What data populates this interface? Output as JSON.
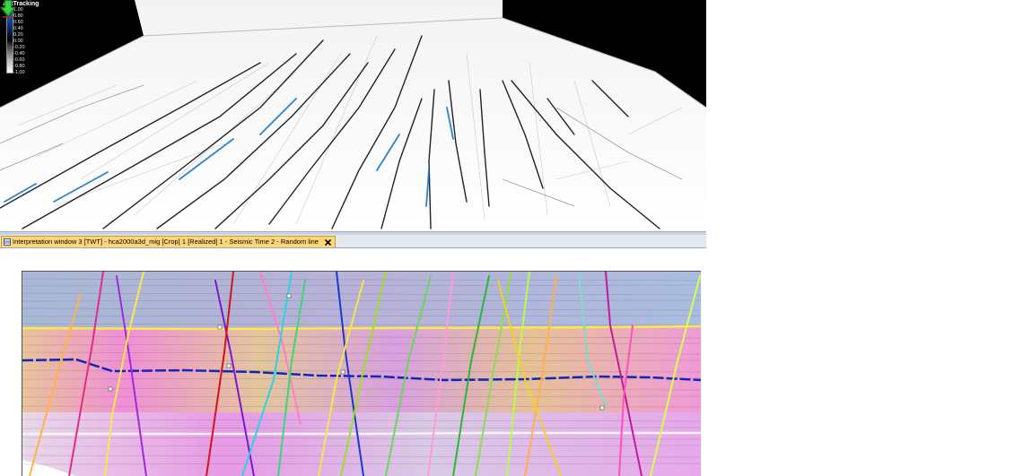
{
  "legend": {
    "title": "AntTracking",
    "ticks": [
      "1.00",
      "0.80",
      "0.60",
      "0.40",
      "0.20",
      "0.00",
      "-0.20",
      "-0.40",
      "-0.60",
      "-0.80",
      "-1.00"
    ]
  },
  "tab": {
    "label": "Interpretation window 3 [TWT] - hca2000a3d_mig [Crop] 1 [Realized] 1 - Seismic Time 2 - Random line"
  },
  "icons": {
    "tab": "interpretation-window-icon",
    "close": "close-icon",
    "navigate": "green-down-arrow-icon"
  },
  "colors": {
    "tab_active": "#ffd77a",
    "horizon_top": "#ffe64a",
    "horizon_mid": "#1326b8",
    "horizon_bottom": "#f4f4f4",
    "ant_strong": "#0a7bd4"
  }
}
